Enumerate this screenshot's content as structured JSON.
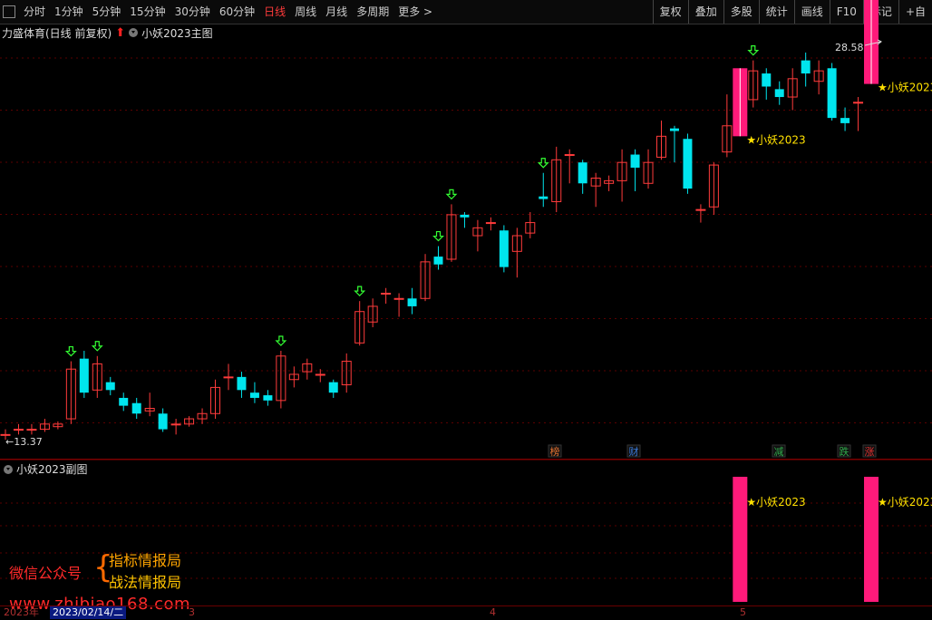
{
  "toolbar": {
    "periods": [
      "分时",
      "1分钟",
      "5分钟",
      "15分钟",
      "30分钟",
      "60分钟",
      "日线",
      "周线",
      "月线",
      "多周期",
      "更多 >"
    ],
    "active_period": "日线",
    "tools": [
      "复权",
      "叠加",
      "多股",
      "统计",
      "画线",
      "F10",
      "标记",
      "+自"
    ]
  },
  "header": {
    "stock_title": "力盛体育(日线 前复权)",
    "indicator_main": "小妖2023主图"
  },
  "sub_panel": {
    "title": "小妖2023副图"
  },
  "price_labels": {
    "high": "28.58",
    "low": "13.37"
  },
  "signal_label": "★小妖2023",
  "events": [
    "榜",
    "财",
    "减",
    "跌",
    "涨"
  ],
  "event_colors": [
    "#e07030",
    "#3a7ad8",
    "#2fa84a",
    "#2fa84a",
    "#e03030"
  ],
  "watermark": {
    "left": "微信公众号",
    "line1": "指标情报局",
    "line2": "战法情报局",
    "url": "www.zhibiao168.com"
  },
  "date_axis": {
    "year": "2023年",
    "cursor_date": "2023/02/14/二",
    "m3": "3",
    "m4": "4",
    "m5": "5"
  },
  "colors": {
    "up": "#ff3b3b",
    "down": "#00e5ee",
    "signal": "#ff1a7a",
    "arrow": "#33ff33"
  },
  "chart_data": {
    "type": "candlestick",
    "title": "力盛体育(日线 前复权)",
    "ylim": [
      13.37,
      28.58
    ],
    "series": [
      {
        "o": 13.6,
        "c": 13.6,
        "h": 13.8,
        "l": 13.4
      },
      {
        "o": 13.8,
        "c": 13.8,
        "h": 14.0,
        "l": 13.6
      },
      {
        "o": 13.8,
        "c": 13.8,
        "h": 14.0,
        "l": 13.6
      },
      {
        "o": 13.8,
        "c": 14.0,
        "h": 14.2,
        "l": 13.7
      },
      {
        "o": 13.9,
        "c": 14.0,
        "h": 14.1,
        "l": 13.8
      },
      {
        "o": 14.2,
        "c": 16.1,
        "h": 16.4,
        "l": 14.0
      },
      {
        "o": 16.5,
        "c": 15.2,
        "h": 16.8,
        "l": 15.0
      },
      {
        "o": 15.3,
        "c": 16.3,
        "h": 16.6,
        "l": 15.0
      },
      {
        "o": 15.6,
        "c": 15.3,
        "h": 15.8,
        "l": 15.1
      },
      {
        "o": 15.0,
        "c": 14.7,
        "h": 15.2,
        "l": 14.5
      },
      {
        "o": 14.8,
        "c": 14.4,
        "h": 15.0,
        "l": 14.2
      },
      {
        "o": 14.5,
        "c": 14.6,
        "h": 15.2,
        "l": 14.3
      },
      {
        "o": 14.4,
        "c": 13.8,
        "h": 14.6,
        "l": 13.7
      },
      {
        "o": 14.0,
        "c": 14.0,
        "h": 14.2,
        "l": 13.6
      },
      {
        "o": 14.0,
        "c": 14.2,
        "h": 14.3,
        "l": 13.9
      },
      {
        "o": 14.2,
        "c": 14.4,
        "h": 14.6,
        "l": 14.0
      },
      {
        "o": 14.4,
        "c": 15.4,
        "h": 15.7,
        "l": 14.2
      },
      {
        "o": 15.8,
        "c": 15.8,
        "h": 16.3,
        "l": 15.3
      },
      {
        "o": 15.8,
        "c": 15.3,
        "h": 16.0,
        "l": 15.0
      },
      {
        "o": 15.2,
        "c": 15.0,
        "h": 15.6,
        "l": 14.8
      },
      {
        "o": 15.1,
        "c": 14.9,
        "h": 15.3,
        "l": 14.7
      },
      {
        "o": 14.9,
        "c": 16.6,
        "h": 16.8,
        "l": 14.6
      },
      {
        "o": 15.7,
        "c": 15.9,
        "h": 16.2,
        "l": 15.4
      },
      {
        "o": 16.0,
        "c": 16.3,
        "h": 16.5,
        "l": 15.7
      },
      {
        "o": 15.9,
        "c": 15.9,
        "h": 16.1,
        "l": 15.6
      },
      {
        "o": 15.6,
        "c": 15.2,
        "h": 15.7,
        "l": 15.0
      },
      {
        "o": 15.5,
        "c": 16.4,
        "h": 16.7,
        "l": 15.2
      },
      {
        "o": 17.1,
        "c": 18.3,
        "h": 18.7,
        "l": 17.0
      },
      {
        "o": 17.9,
        "c": 18.5,
        "h": 18.8,
        "l": 17.7
      },
      {
        "o": 19.0,
        "c": 19.0,
        "h": 19.2,
        "l": 18.6
      },
      {
        "o": 18.8,
        "c": 18.8,
        "h": 19.0,
        "l": 18.1
      },
      {
        "o": 18.8,
        "c": 18.5,
        "h": 19.2,
        "l": 18.2
      },
      {
        "o": 18.8,
        "c": 20.2,
        "h": 20.5,
        "l": 18.7
      },
      {
        "o": 20.4,
        "c": 20.1,
        "h": 20.8,
        "l": 19.9
      },
      {
        "o": 20.3,
        "c": 22.0,
        "h": 22.4,
        "l": 20.2
      },
      {
        "o": 22.0,
        "c": 21.9,
        "h": 22.1,
        "l": 21.5
      },
      {
        "o": 21.2,
        "c": 21.5,
        "h": 21.8,
        "l": 20.6
      },
      {
        "o": 21.7,
        "c": 21.7,
        "h": 21.9,
        "l": 21.4
      },
      {
        "o": 21.4,
        "c": 20.0,
        "h": 21.6,
        "l": 19.8
      },
      {
        "o": 20.6,
        "c": 21.2,
        "h": 21.5,
        "l": 19.6
      },
      {
        "o": 21.3,
        "c": 21.7,
        "h": 22.1,
        "l": 21.1
      },
      {
        "o": 22.7,
        "c": 22.6,
        "h": 23.6,
        "l": 22.3
      },
      {
        "o": 22.5,
        "c": 24.1,
        "h": 24.6,
        "l": 22.1
      },
      {
        "o": 24.3,
        "c": 24.3,
        "h": 24.5,
        "l": 23.2
      },
      {
        "o": 24.0,
        "c": 23.2,
        "h": 24.1,
        "l": 22.8
      },
      {
        "o": 23.1,
        "c": 23.4,
        "h": 23.6,
        "l": 22.3
      },
      {
        "o": 23.2,
        "c": 23.3,
        "h": 23.5,
        "l": 22.9
      },
      {
        "o": 23.3,
        "c": 24.0,
        "h": 24.5,
        "l": 22.5
      },
      {
        "o": 24.3,
        "c": 23.8,
        "h": 24.5,
        "l": 22.9
      },
      {
        "o": 23.2,
        "c": 24.0,
        "h": 24.5,
        "l": 23.0
      },
      {
        "o": 24.2,
        "c": 25.0,
        "h": 25.6,
        "l": 24.1
      },
      {
        "o": 25.3,
        "c": 25.2,
        "h": 25.4,
        "l": 24.0
      },
      {
        "o": 24.9,
        "c": 23.0,
        "h": 25.1,
        "l": 22.8
      },
      {
        "o": 22.2,
        "c": 22.2,
        "h": 22.4,
        "l": 21.7
      },
      {
        "o": 22.3,
        "c": 23.9,
        "h": 24.0,
        "l": 22.0
      },
      {
        "o": 24.4,
        "c": 25.4,
        "h": 26.6,
        "l": 24.2
      },
      {
        "o": 25.5,
        "c": 25.5,
        "h": 26.5,
        "l": 25.3
      },
      {
        "o": 26.4,
        "c": 27.5,
        "h": 27.9,
        "l": 26.1
      },
      {
        "o": 27.4,
        "c": 26.9,
        "h": 27.6,
        "l": 26.4
      },
      {
        "o": 26.8,
        "c": 26.5,
        "h": 27.1,
        "l": 26.2
      },
      {
        "o": 26.5,
        "c": 27.2,
        "h": 27.6,
        "l": 26.0
      },
      {
        "o": 27.9,
        "c": 27.4,
        "h": 28.2,
        "l": 26.9
      },
      {
        "o": 27.1,
        "c": 27.5,
        "h": 27.9,
        "l": 26.6
      },
      {
        "o": 27.6,
        "c": 25.7,
        "h": 27.8,
        "l": 25.6
      },
      {
        "o": 25.7,
        "c": 25.5,
        "h": 26.1,
        "l": 25.2
      },
      {
        "o": 26.3,
        "c": 26.3,
        "h": 26.5,
        "l": 25.2
      },
      {
        "o": 27.5,
        "c": 28.1,
        "h": 28.6,
        "l": 27.1
      }
    ],
    "down_arrows_at": [
      5,
      7,
      21,
      27,
      33,
      34,
      41,
      57
    ],
    "signal_candles_at": [
      56,
      66
    ],
    "subpanel_bars_at": [
      56,
      66
    ]
  }
}
